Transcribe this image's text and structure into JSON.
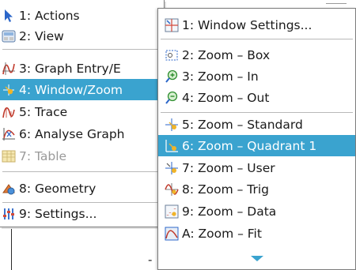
{
  "background": {
    "stray_glyph": "-"
  },
  "main_menu": {
    "items": [
      {
        "label": "1: Actions",
        "icon": "cursor-arrow-icon",
        "state": "normal"
      },
      {
        "label": "2: View",
        "icon": "view-screen-icon",
        "state": "normal"
      },
      {
        "label": "3: Graph Entry/E",
        "icon": "graph-entry-icon",
        "state": "normal"
      },
      {
        "label": "4: Window/Zoom",
        "icon": "window-zoom-icon",
        "state": "active"
      },
      {
        "label": "5: Trace",
        "icon": "trace-icon",
        "state": "normal"
      },
      {
        "label": "6: Analyse Graph",
        "icon": "analyse-graph-icon",
        "state": "normal"
      },
      {
        "label": "7: Table",
        "icon": "table-icon",
        "state": "disabled"
      },
      {
        "label": "8: Geometry",
        "icon": "geometry-icon",
        "state": "normal"
      },
      {
        "label": "9: Settings...",
        "icon": "settings-sliders-icon",
        "state": "normal"
      }
    ]
  },
  "sub_menu": {
    "items": [
      {
        "label": "1: Window Settings...",
        "icon": "window-settings-icon",
        "state": "normal"
      },
      {
        "label": "2: Zoom – Box",
        "icon": "zoom-box-icon",
        "state": "normal"
      },
      {
        "label": "3: Zoom – In",
        "icon": "zoom-in-icon",
        "state": "normal"
      },
      {
        "label": "4: Zoom – Out",
        "icon": "zoom-out-icon",
        "state": "normal"
      },
      {
        "label": "5: Zoom – Standard",
        "icon": "zoom-standard-icon",
        "state": "normal"
      },
      {
        "label": "6: Zoom – Quadrant 1",
        "icon": "zoom-quadrant-icon",
        "state": "active"
      },
      {
        "label": "7: Zoom – User",
        "icon": "zoom-user-icon",
        "state": "normal"
      },
      {
        "label": "8: Zoom – Trig",
        "icon": "zoom-trig-icon",
        "state": "normal"
      },
      {
        "label": "9: Zoom – Data",
        "icon": "zoom-data-icon",
        "state": "normal"
      },
      {
        "label": "A: Zoom – Fit",
        "icon": "zoom-fit-icon",
        "state": "normal"
      }
    ],
    "scroll_indicator": "scroll-down-arrow-icon"
  },
  "colors": {
    "highlight": "#3aa3cf",
    "disabled_text": "#9a9a9a",
    "text": "#1a1a1a"
  }
}
